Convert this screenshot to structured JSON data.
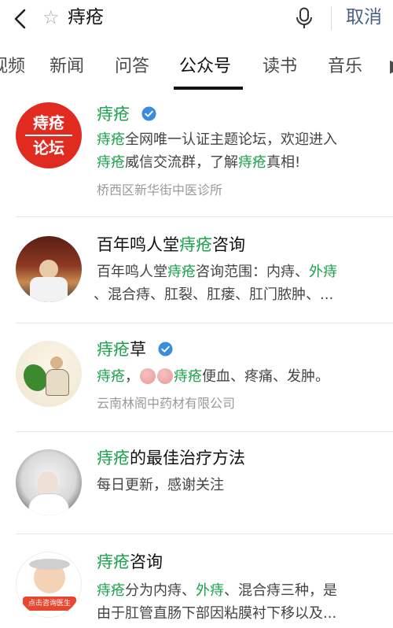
{
  "search": {
    "query": "痔疮",
    "cancel_label": "取消"
  },
  "tabs": [
    {
      "label": "视频"
    },
    {
      "label": "新闻"
    },
    {
      "label": "问答"
    },
    {
      "label": "公众号",
      "active": true
    },
    {
      "label": "读书"
    },
    {
      "label": "音乐"
    }
  ],
  "colors": {
    "highlight": "#1aa14a",
    "cancel": "#4a5f86",
    "verified": "#3d8bdb",
    "meta": "#9a9a9a"
  },
  "results": [
    {
      "avatar_text": [
        "痔疮",
        "论坛"
      ],
      "title_hl": "痔疮",
      "title_rest": "",
      "verified": true,
      "desc_line1": {
        "a": "痔疮",
        "b": "全网唯一认证主题论坛，欢迎进入"
      },
      "desc_line2": {
        "a": "痔疮",
        "b": "威信交流群，了解",
        "c": "痔疮",
        "d": "真相!"
      },
      "meta": "桥西区新华街中医诊所"
    },
    {
      "title_pre": "百年鸣人堂",
      "title_hl": "痔疮",
      "title_rest": "咨询",
      "desc_line1": {
        "a": "百年鸣人堂",
        "b": "痔疮",
        "c": "咨询范围：内痔、",
        "d": "外痔"
      },
      "desc_line2": "、混合痔、肛裂、肛瘘、肛门脓肿、..."
    },
    {
      "title_hl": "痔疮",
      "title_rest": "草",
      "verified": true,
      "desc_line1": {
        "a": "痔疮",
        "b": "，",
        "c": "痔疮",
        "d": "便血、疼痛、发肿。"
      },
      "meta": "云南林阁中药材有限公司"
    },
    {
      "title_hl": "痔疮",
      "title_rest": "的最佳治疗方法",
      "desc_line1": "每日更新，感谢关注"
    },
    {
      "avatar_badge": "点击咨询医生",
      "title_hl": "痔疮",
      "title_rest": "咨询",
      "desc_line1": {
        "a": "痔疮",
        "b": "分为内痔、",
        "c": "外痔",
        "d": "、混合痔三种，是"
      },
      "desc_line2": "由于肛管直肠下部因粘膜衬下移以及..."
    }
  ]
}
